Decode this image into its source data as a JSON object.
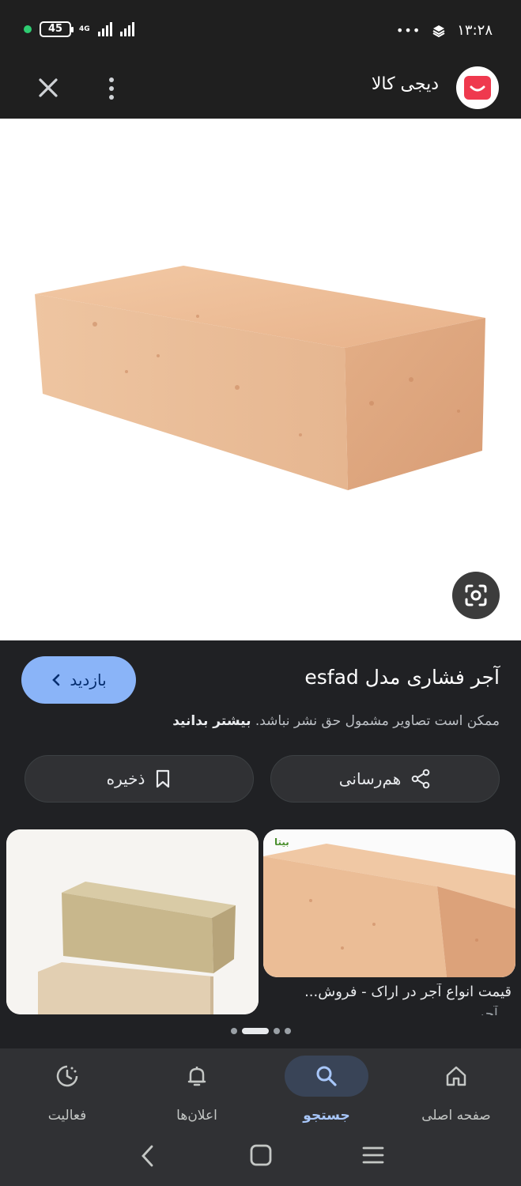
{
  "status_bar": {
    "battery": "45",
    "network": "4G",
    "more": "•••",
    "time": "۱۳:۲۸"
  },
  "app_bar": {
    "site_name": "دیجی کالا"
  },
  "result": {
    "title": "آجر فشاری مدل esfad",
    "visit_label": "بازدید",
    "copyright_text": "ممکن است تصاویر مشمول حق نشر نباشد.",
    "learn_more": "بیشتر بدانید",
    "share_label": "هم‌رسانی",
    "save_label": "ذخیره"
  },
  "related": {
    "cards": [
      {
        "caption": "قیمت انواع آجر در اراک - فروش...",
        "caption_line2": "...آجر"
      },
      {
        "caption": ""
      }
    ],
    "watermark": "بیتا"
  },
  "bottom_nav": {
    "items": [
      {
        "label": "صفحه اصلی",
        "icon": "home-icon"
      },
      {
        "label": "جستجو",
        "icon": "search-icon",
        "active": true
      },
      {
        "label": "اعلان‌ها",
        "icon": "bell-icon"
      },
      {
        "label": "فعالیت",
        "icon": "activity-icon"
      }
    ]
  },
  "colors": {
    "background": "#1f1f1f",
    "accent": "#8ab4f8",
    "brand": "#ef394e"
  }
}
